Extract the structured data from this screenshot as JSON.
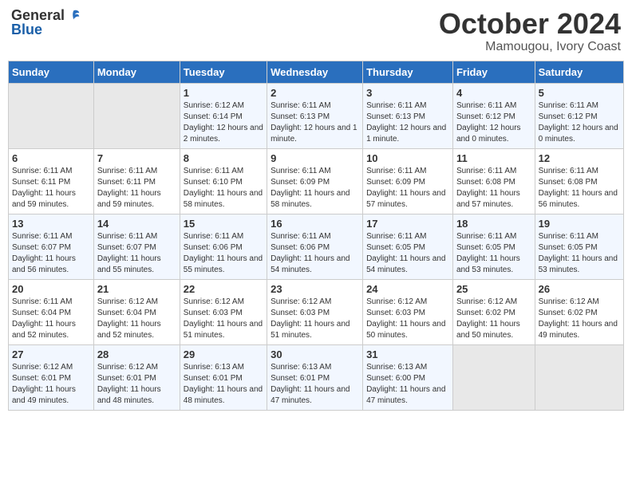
{
  "header": {
    "logo_general": "General",
    "logo_blue": "Blue",
    "title": "October 2024",
    "location": "Mamougou, Ivory Coast"
  },
  "calendar": {
    "weekdays": [
      "Sunday",
      "Monday",
      "Tuesday",
      "Wednesday",
      "Thursday",
      "Friday",
      "Saturday"
    ],
    "weeks": [
      [
        {
          "day": "",
          "empty": true
        },
        {
          "day": "",
          "empty": true
        },
        {
          "day": "1",
          "sunrise": "6:12 AM",
          "sunset": "6:14 PM",
          "daylight": "12 hours and 2 minutes."
        },
        {
          "day": "2",
          "sunrise": "6:11 AM",
          "sunset": "6:13 PM",
          "daylight": "12 hours and 1 minute."
        },
        {
          "day": "3",
          "sunrise": "6:11 AM",
          "sunset": "6:13 PM",
          "daylight": "12 hours and 1 minute."
        },
        {
          "day": "4",
          "sunrise": "6:11 AM",
          "sunset": "6:12 PM",
          "daylight": "12 hours and 0 minutes."
        },
        {
          "day": "5",
          "sunrise": "6:11 AM",
          "sunset": "6:12 PM",
          "daylight": "12 hours and 0 minutes."
        }
      ],
      [
        {
          "day": "6",
          "sunrise": "6:11 AM",
          "sunset": "6:11 PM",
          "daylight": "11 hours and 59 minutes."
        },
        {
          "day": "7",
          "sunrise": "6:11 AM",
          "sunset": "6:11 PM",
          "daylight": "11 hours and 59 minutes."
        },
        {
          "day": "8",
          "sunrise": "6:11 AM",
          "sunset": "6:10 PM",
          "daylight": "11 hours and 58 minutes."
        },
        {
          "day": "9",
          "sunrise": "6:11 AM",
          "sunset": "6:09 PM",
          "daylight": "11 hours and 58 minutes."
        },
        {
          "day": "10",
          "sunrise": "6:11 AM",
          "sunset": "6:09 PM",
          "daylight": "11 hours and 57 minutes."
        },
        {
          "day": "11",
          "sunrise": "6:11 AM",
          "sunset": "6:08 PM",
          "daylight": "11 hours and 57 minutes."
        },
        {
          "day": "12",
          "sunrise": "6:11 AM",
          "sunset": "6:08 PM",
          "daylight": "11 hours and 56 minutes."
        }
      ],
      [
        {
          "day": "13",
          "sunrise": "6:11 AM",
          "sunset": "6:07 PM",
          "daylight": "11 hours and 56 minutes."
        },
        {
          "day": "14",
          "sunrise": "6:11 AM",
          "sunset": "6:07 PM",
          "daylight": "11 hours and 55 minutes."
        },
        {
          "day": "15",
          "sunrise": "6:11 AM",
          "sunset": "6:06 PM",
          "daylight": "11 hours and 55 minutes."
        },
        {
          "day": "16",
          "sunrise": "6:11 AM",
          "sunset": "6:06 PM",
          "daylight": "11 hours and 54 minutes."
        },
        {
          "day": "17",
          "sunrise": "6:11 AM",
          "sunset": "6:05 PM",
          "daylight": "11 hours and 54 minutes."
        },
        {
          "day": "18",
          "sunrise": "6:11 AM",
          "sunset": "6:05 PM",
          "daylight": "11 hours and 53 minutes."
        },
        {
          "day": "19",
          "sunrise": "6:11 AM",
          "sunset": "6:05 PM",
          "daylight": "11 hours and 53 minutes."
        }
      ],
      [
        {
          "day": "20",
          "sunrise": "6:11 AM",
          "sunset": "6:04 PM",
          "daylight": "11 hours and 52 minutes."
        },
        {
          "day": "21",
          "sunrise": "6:12 AM",
          "sunset": "6:04 PM",
          "daylight": "11 hours and 52 minutes."
        },
        {
          "day": "22",
          "sunrise": "6:12 AM",
          "sunset": "6:03 PM",
          "daylight": "11 hours and 51 minutes."
        },
        {
          "day": "23",
          "sunrise": "6:12 AM",
          "sunset": "6:03 PM",
          "daylight": "11 hours and 51 minutes."
        },
        {
          "day": "24",
          "sunrise": "6:12 AM",
          "sunset": "6:03 PM",
          "daylight": "11 hours and 50 minutes."
        },
        {
          "day": "25",
          "sunrise": "6:12 AM",
          "sunset": "6:02 PM",
          "daylight": "11 hours and 50 minutes."
        },
        {
          "day": "26",
          "sunrise": "6:12 AM",
          "sunset": "6:02 PM",
          "daylight": "11 hours and 49 minutes."
        }
      ],
      [
        {
          "day": "27",
          "sunrise": "6:12 AM",
          "sunset": "6:01 PM",
          "daylight": "11 hours and 49 minutes."
        },
        {
          "day": "28",
          "sunrise": "6:12 AM",
          "sunset": "6:01 PM",
          "daylight": "11 hours and 48 minutes."
        },
        {
          "day": "29",
          "sunrise": "6:13 AM",
          "sunset": "6:01 PM",
          "daylight": "11 hours and 48 minutes."
        },
        {
          "day": "30",
          "sunrise": "6:13 AM",
          "sunset": "6:01 PM",
          "daylight": "11 hours and 47 minutes."
        },
        {
          "day": "31",
          "sunrise": "6:13 AM",
          "sunset": "6:00 PM",
          "daylight": "11 hours and 47 minutes."
        },
        {
          "day": "",
          "empty": true
        },
        {
          "day": "",
          "empty": true
        }
      ]
    ],
    "labels": {
      "sunrise": "Sunrise:",
      "sunset": "Sunset:",
      "daylight": "Daylight:"
    }
  }
}
